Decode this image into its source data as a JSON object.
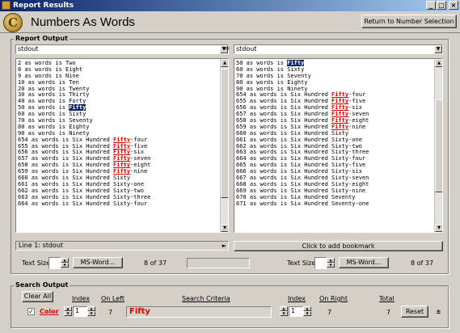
{
  "window": {
    "title": "Report Results",
    "minimize": "_",
    "maximize": "□",
    "close": "×"
  },
  "header": {
    "logo_glyph": "C",
    "title": "Numbers As Words",
    "return_button": "Return to Number Selection"
  },
  "report_output": {
    "label": "Report Output",
    "left_combo": "stdout",
    "right_combo": "stdout",
    "left_lines": [
      [
        {
          "t": "2 as words is Two"
        }
      ],
      [
        {
          "t": "8 as words is Eight"
        }
      ],
      [
        {
          "t": "9 as words is Nine"
        }
      ],
      [
        {
          "t": "10 as words is Ten"
        }
      ],
      [
        {
          "t": "20 as words is Twenty"
        }
      ],
      [
        {
          "t": "30 as words is Thirty"
        }
      ],
      [
        {
          "t": "40 as words is Forty"
        }
      ],
      [
        {
          "t": "50 as words is "
        },
        {
          "t": "Fifty",
          "s": "sel"
        }
      ],
      [
        {
          "t": "60 as words is Sixty"
        }
      ],
      [
        {
          "t": "70 as words is Seventy"
        }
      ],
      [
        {
          "t": "80 as words is Eighty"
        }
      ],
      [
        {
          "t": "90 as words is Ninety"
        }
      ],
      [
        {
          "t": "654 as words is Six Hundred "
        },
        {
          "t": "Fifty",
          "s": "red"
        },
        {
          "t": "-four"
        }
      ],
      [
        {
          "t": "655 as words is Six Hundred "
        },
        {
          "t": "Fifty",
          "s": "red"
        },
        {
          "t": "-five"
        }
      ],
      [
        {
          "t": "656 as words is Six Hundred "
        },
        {
          "t": "Fifty",
          "s": "red"
        },
        {
          "t": "-six"
        }
      ],
      [
        {
          "t": "657 as words is Six Hundred "
        },
        {
          "t": "Fifty",
          "s": "red"
        },
        {
          "t": "-seven"
        }
      ],
      [
        {
          "t": "658 as words is Six Hundred "
        },
        {
          "t": "Fifty",
          "s": "red"
        },
        {
          "t": "-eight"
        }
      ],
      [
        {
          "t": "659 as words is Six Hundred "
        },
        {
          "t": "Fifty",
          "s": "red"
        },
        {
          "t": "-nine"
        }
      ],
      [
        {
          "t": "660 as words is Six Hundred Sixty"
        }
      ],
      [
        {
          "t": "661 as words is Six Hundred Sixty-one"
        }
      ],
      [
        {
          "t": "662 as words is Six Hundred Sixty-two"
        }
      ],
      [
        {
          "t": "663 as words is Six Hundred Sixty-three"
        }
      ],
      [
        {
          "t": "664 as words is Six Hundred Sixty-four"
        }
      ]
    ],
    "right_lines": [
      [
        {
          "t": "50 as words is "
        },
        {
          "t": "Fifty",
          "s": "sel"
        }
      ],
      [
        {
          "t": "60 as words is Sixty"
        }
      ],
      [
        {
          "t": "70 as words is Seventy"
        }
      ],
      [
        {
          "t": "80 as words is Eighty"
        }
      ],
      [
        {
          "t": "90 as words is Ninety"
        }
      ],
      [
        {
          "t": "654 as words is Six Hundred "
        },
        {
          "t": "Fifty",
          "s": "red"
        },
        {
          "t": "-four"
        }
      ],
      [
        {
          "t": "655 as words is Six Hundred "
        },
        {
          "t": "Fifty",
          "s": "red"
        },
        {
          "t": "-five"
        }
      ],
      [
        {
          "t": "656 as words is Six Hundred "
        },
        {
          "t": "Fifty",
          "s": "red"
        },
        {
          "t": "-six"
        }
      ],
      [
        {
          "t": "657 as words is Six Hundred "
        },
        {
          "t": "Fifty",
          "s": "red"
        },
        {
          "t": "-seven"
        }
      ],
      [
        {
          "t": "658 as words is Six Hundred "
        },
        {
          "t": "Fifty",
          "s": "red"
        },
        {
          "t": "-eight"
        }
      ],
      [
        {
          "t": "659 as words is Six Hundred "
        },
        {
          "t": "Fifty",
          "s": "red"
        },
        {
          "t": "-nine"
        }
      ],
      [
        {
          "t": "660 as words is Six Hundred Sixty"
        }
      ],
      [
        {
          "t": "661 as words is Six Hundred Sixty-one"
        }
      ],
      [
        {
          "t": "662 as words is Six Hundred Sixty-two"
        }
      ],
      [
        {
          "t": "663 as words is Six Hundred Sixty-three"
        }
      ],
      [
        {
          "t": "664 as words is Six Hundred Sixty-four"
        }
      ],
      [
        {
          "t": "665 as words is Six Hundred Sixty-five"
        }
      ],
      [
        {
          "t": "666 as words is Six Hundred Sixty-six"
        }
      ],
      [
        {
          "t": "667 as words is Six Hundred Sixty-seven"
        }
      ],
      [
        {
          "t": "668 as words is Six Hundred Sixty-eight"
        }
      ],
      [
        {
          "t": "669 as words is Six Hundred Sixty-nine"
        }
      ],
      [
        {
          "t": "670 as words is Six Hundred Seventy"
        }
      ],
      [
        {
          "t": "671 as words is Six Hundred Seventy-one"
        }
      ]
    ],
    "line_status": "Line 1:  stdout",
    "bookmark_button": "Click to add bookmark",
    "left_controls": {
      "text_size_label": "Text Size:",
      "msword_button": "MS-Word...",
      "count": "8 of 37"
    },
    "right_controls": {
      "text_size_label": "Text Size:",
      "msword_button": "MS-Word...",
      "count": "8 of 37"
    }
  },
  "search_output": {
    "label": "Search Output",
    "clear_all": "Clear All",
    "headers": {
      "index": "Index",
      "on_left": "On Left",
      "search_criteria": "Search Criteria",
      "index2": "Index",
      "on_right": "On Right",
      "total": "Total"
    },
    "row": {
      "checked": true,
      "color_label": "Color",
      "index_left": "1",
      "on_left": "7",
      "criteria": "Fifty",
      "index_right": "1",
      "on_right": "7",
      "total": "7"
    },
    "reset": "Reset",
    "plusminus": "±"
  },
  "colors": {
    "selection": "#0a246a",
    "match": "#e00000",
    "criteria_bg": "#d8d4cc",
    "criteria_text": "#e00000"
  }
}
